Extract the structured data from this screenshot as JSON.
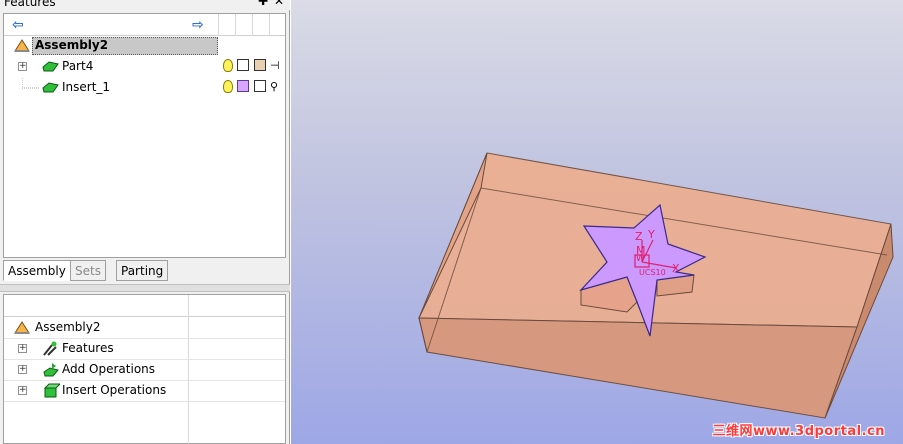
{
  "panel": {
    "title": "Features",
    "pin_icon": "pin-icon",
    "close_icon": "close-icon"
  },
  "feature_tree": {
    "back_icon": "arrow-left-icon",
    "forward_icon": "arrow-right-icon",
    "root": {
      "label": "Assembly2",
      "icon": "assembly-icon"
    },
    "items": [
      {
        "label": "Part4",
        "icon": "part-icon",
        "expand": "+"
      },
      {
        "label": "Insert_1",
        "icon": "part-icon",
        "expand": ""
      }
    ]
  },
  "tabs": [
    {
      "label": "Assembly",
      "active": true
    },
    {
      "label": "Sets",
      "active": false
    },
    {
      "label": "Parting",
      "active": false
    }
  ],
  "operations_tree": {
    "root": {
      "label": "Assembly2",
      "icon": "assembly-icon"
    },
    "items": [
      {
        "label": "Features",
        "icon": "features-icon",
        "expand": "+"
      },
      {
        "label": "Add Operations",
        "icon": "add-operations-icon",
        "expand": "+"
      },
      {
        "label": "Insert Operations",
        "icon": "insert-operations-icon",
        "expand": "+"
      }
    ]
  },
  "viewport": {
    "axis_labels": {
      "z": "Z",
      "y": "Y",
      "x": "X",
      "m": "M",
      "w": "W"
    },
    "ucs_label": "UCS10",
    "watermark": "三维网www.3dportal.cn",
    "colors": {
      "block": "#eeae8e",
      "star": "#cc99ff",
      "axis": "#e0206a"
    }
  }
}
